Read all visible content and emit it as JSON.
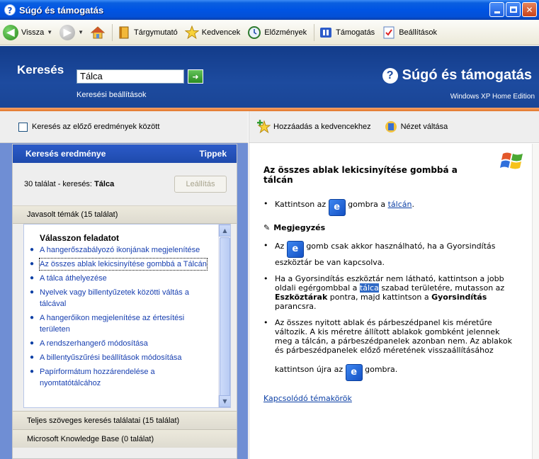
{
  "window": {
    "title": "Súgó és támogatás"
  },
  "toolbar": {
    "back_label": "Vissza",
    "index_label": "Tárgymutató",
    "favorites_label": "Kedvencek",
    "history_label": "Előzmények",
    "support_label": "Támogatás",
    "options_label": "Beállítások"
  },
  "search": {
    "label": "Keresés",
    "value": "Tálca",
    "options_link": "Keresési beállítások",
    "brand_title": "Súgó és támogatás",
    "edition": "Windows XP Home Edition"
  },
  "left": {
    "search_previous_label": "Keresés az előző eredmények között",
    "results_header": "Keresés eredménye",
    "tips_label": "Tippek",
    "count_prefix": "30 találat - keresés:",
    "count_term": "Tálca",
    "stop_button": "Leállítás",
    "suggested_topics": "Javasolt témák (15 találat)",
    "choose_task": "Válasszon feladatot",
    "topics": [
      "A hangerőszabályozó ikonjának megjelenítése",
      "Az összes ablak lekicsinyítése gombbá a Tálcán",
      "A tálca áthelyezése",
      "Nyelvek vagy billentyűzetek közötti váltás a tálcával",
      "A hangerőikon megjelenítése az értesítési területen",
      "A rendszerhangerő módosítása",
      "A billentyűszűrési beállítások módosítása",
      "Papírformátum hozzárendelése a nyomtatótálcához"
    ],
    "fulltext_results": "Teljes szöveges keresés találatai (15 találat)",
    "kb_results": "Microsoft Knowledge Base (0 találat)"
  },
  "right": {
    "add_favorites": "Hozzáadás a kedvencekhez",
    "change_view": "Nézet váltása",
    "article_title": "Az összes ablak lekicsinyítése gombbá a tálcán",
    "step1_prefix": "Kattintson az",
    "step1_mid": "gombra a",
    "step1_link": "tálcán",
    "step1_suffix": ".",
    "note_heading": "Megjegyzés",
    "note1_prefix": "Az",
    "note1_suffix": "gomb csak akkor használható, ha a Gyorsindítás eszköztár be van kapcsolva.",
    "note2_a": "Ha a Gyorsindítás eszköztár nem látható, kattintson a jobb oldali egérgombbal a",
    "note2_hl": "tálca",
    "note2_b": "szabad területére, mutasson az",
    "note2_bold1": "Eszköztárak",
    "note2_c": "pontra, majd kattintson a",
    "note2_bold2": "Gyorsindítás",
    "note2_d": "parancsra.",
    "note3_a": "Az összes nyitott ablak és párbeszédpanel kis méretűre változik. A kis méretre állított ablakok gombként jelennek meg a tálcán, a párbeszédpanelek azonban nem. Az ablakok és párbeszédpanelek előző méretének visszaállításához",
    "note3_b": "kattintson újra az",
    "note3_c": "gombra.",
    "related": "Kapcsolódó témakörök"
  },
  "colors": {
    "titlebar": "#0054e3",
    "search_band": "#1d4b9f",
    "link": "#0b3fa5",
    "accent_orange": "#e2772a"
  }
}
